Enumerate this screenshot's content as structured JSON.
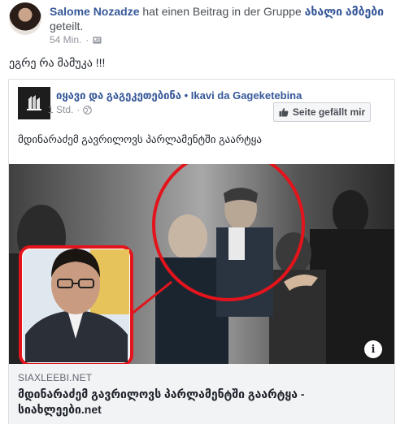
{
  "post": {
    "author": "Salome Nozadze",
    "action_text": " hat einen Beitrag in der Gruppe ",
    "group_name": "ახალი ამბები",
    "action_suffix": " geteilt.",
    "timestamp": "54 Min.",
    "text": "ეგრე რა მამუკა !!!"
  },
  "shared": {
    "page_name": "იყავი და გაგეკეთებინა • Ikavi da Gageketebina",
    "timestamp": "1 Std.",
    "like_page_label": "Seite gefällt mir",
    "text": "მდინარაძემ გავრილოვს პარლამენტში გაარტყა"
  },
  "link": {
    "domain": "SIAXLEEBI.NET",
    "title": "მდინარაძემ გავრილოვს პარლამენტში გაარტყა - სიახლეები.net"
  },
  "colors": {
    "link_blue": "#365899",
    "highlight_red": "#e3141b",
    "link_footer_bg": "#f2f3f5"
  }
}
